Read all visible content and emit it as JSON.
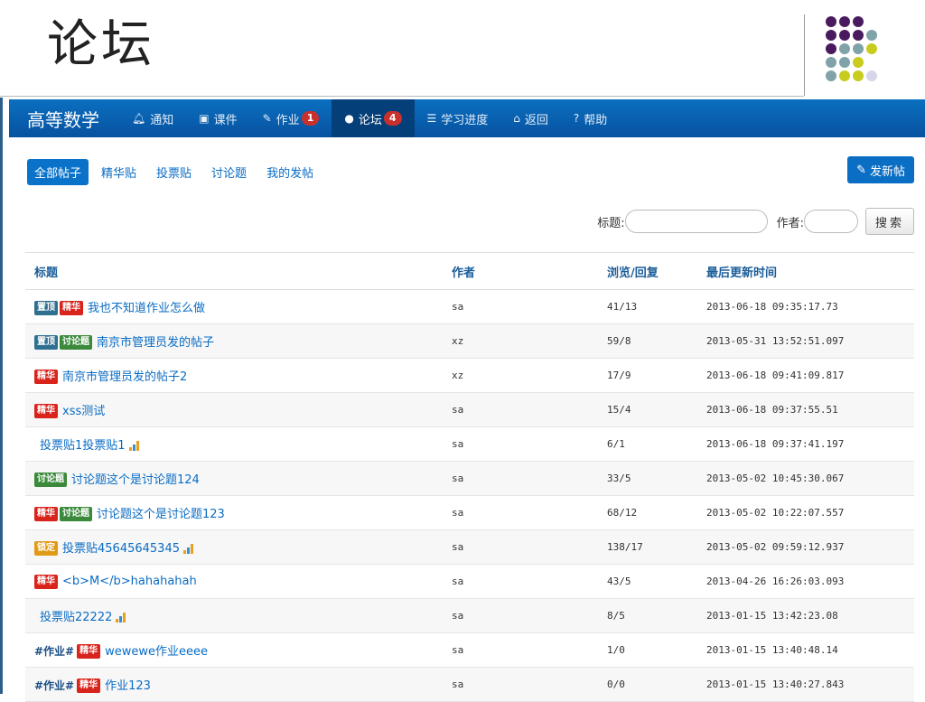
{
  "slide": {
    "title": "论坛"
  },
  "navbar": {
    "brand": "高等数学",
    "items": [
      {
        "label": "通知",
        "icon": "bell-icon",
        "glyph": "🔔︎",
        "badge": ""
      },
      {
        "label": "课件",
        "icon": "film-icon",
        "glyph": "▣",
        "badge": ""
      },
      {
        "label": "作业",
        "icon": "pencil-icon",
        "glyph": "✎",
        "badge": "1"
      },
      {
        "label": "论坛",
        "icon": "comment-icon",
        "glyph": "●",
        "badge": "4",
        "active": true
      },
      {
        "label": "学习进度",
        "icon": "list-icon",
        "glyph": "☰",
        "badge": ""
      },
      {
        "label": "返回",
        "icon": "home-icon",
        "glyph": "⌂",
        "badge": ""
      },
      {
        "label": "帮助",
        "icon": "question-icon",
        "glyph": "?",
        "badge": ""
      }
    ]
  },
  "tabs": [
    {
      "label": "全部帖子",
      "active": true
    },
    {
      "label": "精华贴"
    },
    {
      "label": "投票贴"
    },
    {
      "label": "讨论题"
    },
    {
      "label": "我的发帖"
    }
  ],
  "new_post": {
    "label": "发新帖"
  },
  "search": {
    "title_label": "标题:",
    "author_label": "作者:",
    "title_value": "",
    "author_value": "",
    "button": "搜索"
  },
  "table": {
    "headers": [
      "标题",
      "作者",
      "浏览/回复",
      "最后更新时间"
    ],
    "rows": [
      {
        "prefix": "",
        "badges": [
          "置顶",
          "精华"
        ],
        "title": "我也不知道作业怎么做",
        "poll": false,
        "author": "sa",
        "views": "41/13",
        "updated": "2013-06-18 09:35:17.73"
      },
      {
        "prefix": "",
        "badges": [
          "置顶",
          "讨论题"
        ],
        "title": "南京市管理员发的帖子",
        "poll": false,
        "author": "xz",
        "views": "59/8",
        "updated": "2013-05-31 13:52:51.097"
      },
      {
        "prefix": "",
        "badges": [
          "精华"
        ],
        "title": "南京市管理员发的帖子2",
        "poll": false,
        "author": "xz",
        "views": "17/9",
        "updated": "2013-06-18 09:41:09.817"
      },
      {
        "prefix": "",
        "badges": [
          "精华"
        ],
        "title": "xss测试",
        "poll": false,
        "author": "sa",
        "views": "15/4",
        "updated": "2013-06-18 09:37:55.51"
      },
      {
        "prefix": "",
        "badges": [],
        "title": "投票贴1投票贴1",
        "poll": true,
        "author": "sa",
        "views": "6/1",
        "updated": "2013-06-18 09:37:41.197"
      },
      {
        "prefix": "",
        "badges": [
          "讨论题"
        ],
        "title": "讨论题这个是讨论题124",
        "poll": false,
        "author": "sa",
        "views": "33/5",
        "updated": "2013-05-02 10:45:30.067"
      },
      {
        "prefix": "",
        "badges": [
          "精华",
          "讨论题"
        ],
        "title": "讨论题这个是讨论题123",
        "poll": false,
        "author": "sa",
        "views": "68/12",
        "updated": "2013-05-02 10:22:07.557"
      },
      {
        "prefix": "",
        "badges": [
          "锁定"
        ],
        "title": "投票贴45645645345",
        "poll": true,
        "author": "sa",
        "views": "138/17",
        "updated": "2013-05-02 09:59:12.937"
      },
      {
        "prefix": "",
        "badges": [
          "精华"
        ],
        "title": "<b>M</b>hahahahah",
        "poll": false,
        "author": "sa",
        "views": "43/5",
        "updated": "2013-04-26 16:26:03.093"
      },
      {
        "prefix": "",
        "badges": [],
        "title": "投票贴22222",
        "poll": true,
        "author": "sa",
        "views": "8/5",
        "updated": "2013-01-15 13:42:23.08"
      },
      {
        "prefix": "#作业#",
        "badges": [
          "精华"
        ],
        "title": "wewewe作业eeee",
        "poll": false,
        "author": "sa",
        "views": "1/0",
        "updated": "2013-01-15 13:40:48.14"
      },
      {
        "prefix": "#作业#",
        "badges": [
          "精华"
        ],
        "title": "作业123",
        "poll": false,
        "author": "sa",
        "views": "0/0",
        "updated": "2013-01-15 13:40:27.843"
      }
    ]
  },
  "colors": {
    "nav_bg": "#0a5ea8",
    "accent": "#0a6fc4",
    "badge_top": "#2f6f8f",
    "badge_best": "#d9241c",
    "badge_discussion": "#3b8a3b",
    "badge_locked": "#e09a16",
    "dots": [
      "#4a1a5e",
      "#7fa3a8",
      "#c8cc1e",
      "#d8d6ea"
    ]
  }
}
